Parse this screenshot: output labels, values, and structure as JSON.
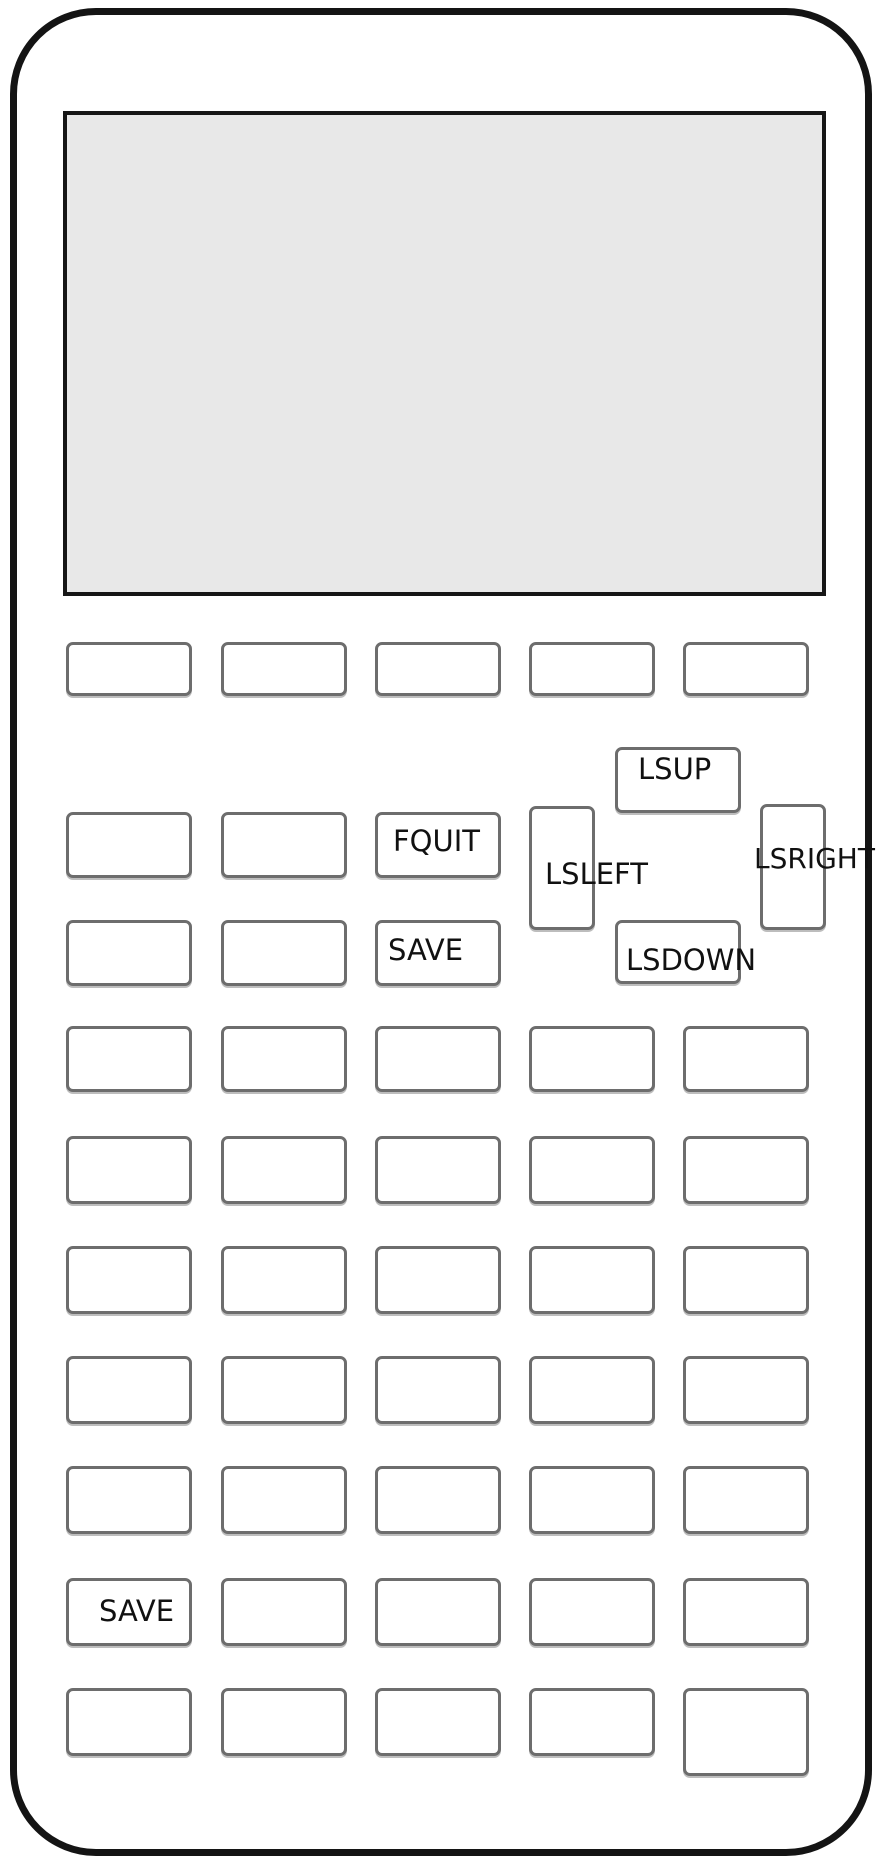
{
  "keys": {
    "fquit": "FQUIT",
    "save_upper": "SAVE",
    "save_lower": "SAVE",
    "lsup": "LSUP",
    "lsleft": "LSLEFT",
    "lsright": "LSRIGHT",
    "lsdown": "LSDOWN"
  }
}
